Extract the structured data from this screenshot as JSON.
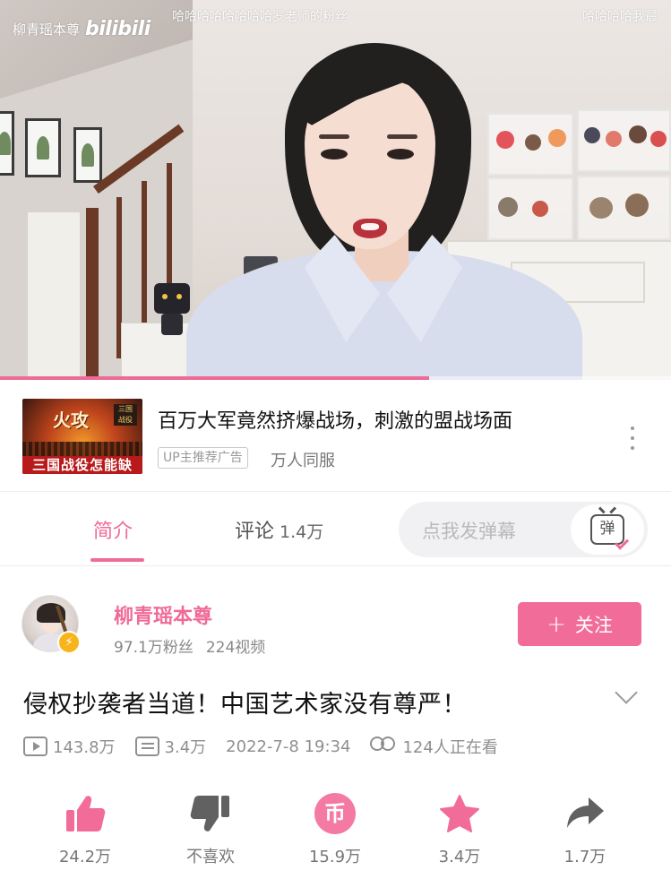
{
  "video": {
    "watermark_name": "柳青瑶本尊",
    "watermark_brand": "bilibili",
    "danmaku": [
      "哈哈哈哈哈哈哈哈罗老师的粉丝",
      "哈哈哈哈我最"
    ],
    "progress": 0.64,
    "accent_color": "#f06a98"
  },
  "ad": {
    "thumb_text": "火攻",
    "thumb_caption": "三国战役怎能缺",
    "title": "百万大军竟然挤爆战场，刺激的盟战场面",
    "tag": "UP主推荐广告",
    "subtitle": "万人同服",
    "more_icon": "more-vertical-icon"
  },
  "tabs": {
    "intro": "简介",
    "comments": "评论",
    "comments_count": "1.4万",
    "danmu_placeholder": "点我发弹幕",
    "danmu_button": "弹"
  },
  "uploader": {
    "name": "柳青瑶本尊",
    "followers": "97.1万粉丝",
    "videos": "224视频",
    "follow_label": "关注",
    "follow_plus": "+"
  },
  "video_info": {
    "title": "侵权抄袭者当道！中国艺术家没有尊严！",
    "views": "143.8万",
    "danmaku_count": "3.4万",
    "date": "2022-7-8 19:34",
    "watching": "124人正在看"
  },
  "actions": [
    {
      "icon": "thumbs-up-icon",
      "label": "24.2万",
      "color": "#f26c9a"
    },
    {
      "icon": "thumbs-down-icon",
      "label": "不喜欢",
      "color": "#616161"
    },
    {
      "icon": "coin-icon",
      "label": "15.9万",
      "color": "#f26c9a",
      "glyph": "币"
    },
    {
      "icon": "star-icon",
      "label": "3.4万",
      "color": "#f26c9a"
    },
    {
      "icon": "share-icon",
      "label": "1.7万",
      "color": "#616161"
    }
  ]
}
